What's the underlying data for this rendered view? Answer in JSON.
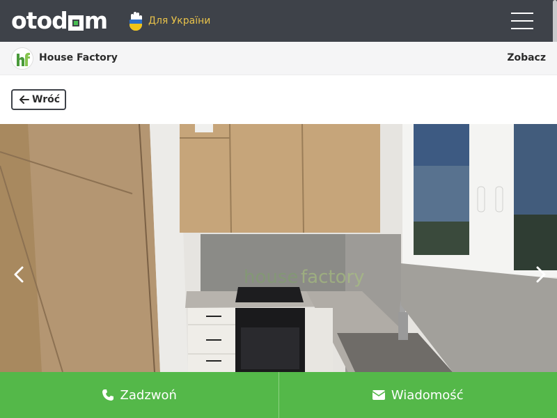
{
  "header": {
    "logo_left": "otod",
    "logo_right": "m",
    "ukraine_label": "Для України",
    "menu_icon": "hamburger-menu-icon"
  },
  "agency": {
    "name": "House Factory",
    "see_label": "Zobacz",
    "logo_icon": "house-factory-logo"
  },
  "back_button": {
    "label": "Wróć",
    "icon": "arrow-left-icon"
  },
  "gallery": {
    "image": "kitchen-photo",
    "watermark": "housefactory",
    "prev_icon": "chevron-left-icon",
    "next_icon": "chevron-right-icon"
  },
  "actions": {
    "call_label": "Zadzwoń",
    "call_icon": "phone-icon",
    "message_label": "Wiadomość",
    "message_icon": "envelope-icon"
  },
  "colors": {
    "topbar": "#3e4249",
    "accent_green": "#54b849",
    "ukraine_yellow": "#e8c24a"
  }
}
